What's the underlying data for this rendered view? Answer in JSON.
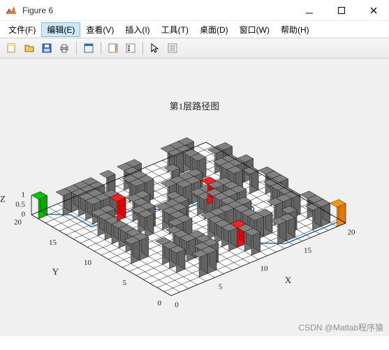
{
  "window": {
    "title": "Figure 6"
  },
  "menu": {
    "items": [
      {
        "label": "文件(F)"
      },
      {
        "label": "编辑(E)"
      },
      {
        "label": "查看(V)"
      },
      {
        "label": "插入(I)"
      },
      {
        "label": "工具(T)"
      },
      {
        "label": "桌面(D)"
      },
      {
        "label": "窗口(W)"
      },
      {
        "label": "帮助(H)"
      }
    ],
    "active_index": 1
  },
  "toolbar": {
    "buttons": [
      {
        "name": "new-figure-icon"
      },
      {
        "name": "open-icon"
      },
      {
        "name": "save-icon"
      },
      {
        "name": "print-icon"
      },
      {
        "name": "sep"
      },
      {
        "name": "edit-plot-icon"
      },
      {
        "name": "sep"
      },
      {
        "name": "insert-colorbar-icon"
      },
      {
        "name": "insert-legend-icon"
      },
      {
        "name": "sep"
      },
      {
        "name": "pointer-icon"
      },
      {
        "name": "data-cursor-icon"
      }
    ]
  },
  "chart_data": {
    "type": "area",
    "title": "第1层路径图",
    "xlabel": "X",
    "ylabel": "Y",
    "zlabel": "Z",
    "xlim": [
      0,
      20
    ],
    "ylim": [
      0,
      20
    ],
    "zlim": [
      0,
      1
    ],
    "xticks": [
      0,
      5,
      10,
      15,
      20
    ],
    "yticks": [
      0,
      5,
      10,
      15,
      20
    ],
    "zticks": [
      0,
      0.5,
      1
    ],
    "grid": {
      "nx": 20,
      "ny": 20
    },
    "obstacles": [
      [
        2,
        18
      ],
      [
        3,
        18
      ],
      [
        4,
        18
      ],
      [
        5,
        18
      ],
      [
        7,
        18
      ],
      [
        9,
        18
      ],
      [
        10,
        18
      ],
      [
        14,
        18
      ],
      [
        15,
        18
      ],
      [
        16,
        18
      ],
      [
        3,
        17
      ],
      [
        4,
        17
      ],
      [
        5,
        17
      ],
      [
        9,
        17
      ],
      [
        14,
        17
      ],
      [
        15,
        17
      ],
      [
        3,
        16
      ],
      [
        4,
        16
      ],
      [
        8,
        16
      ],
      [
        9,
        16
      ],
      [
        15,
        16
      ],
      [
        3,
        15
      ],
      [
        4,
        15
      ],
      [
        5,
        15
      ],
      [
        8,
        15
      ],
      [
        9,
        15
      ],
      [
        12,
        15
      ],
      [
        15,
        15
      ],
      [
        17,
        15
      ],
      [
        18,
        15
      ],
      [
        2,
        13
      ],
      [
        3,
        13
      ],
      [
        6,
        13
      ],
      [
        7,
        13
      ],
      [
        10,
        13
      ],
      [
        11,
        13
      ],
      [
        12,
        13
      ],
      [
        13,
        13
      ],
      [
        16,
        13
      ],
      [
        17,
        13
      ],
      [
        2,
        12
      ],
      [
        6,
        12
      ],
      [
        11,
        12
      ],
      [
        12,
        12
      ],
      [
        16,
        12
      ],
      [
        17,
        12
      ],
      [
        18,
        12
      ],
      [
        2,
        11
      ],
      [
        5,
        11
      ],
      [
        6,
        11
      ],
      [
        9,
        11
      ],
      [
        16,
        11
      ],
      [
        2,
        10
      ],
      [
        5,
        10
      ],
      [
        7,
        10
      ],
      [
        8,
        10
      ],
      [
        9,
        10
      ],
      [
        11,
        10
      ],
      [
        12,
        10
      ],
      [
        13,
        10
      ],
      [
        14,
        10
      ],
      [
        17,
        10
      ],
      [
        2,
        9
      ],
      [
        7,
        9
      ],
      [
        8,
        9
      ],
      [
        11,
        9
      ],
      [
        12,
        9
      ],
      [
        14,
        9
      ],
      [
        18,
        9
      ],
      [
        2,
        8
      ],
      [
        7,
        8
      ],
      [
        12,
        8
      ],
      [
        13,
        8
      ],
      [
        14,
        8
      ],
      [
        18,
        8
      ],
      [
        1,
        7
      ],
      [
        2,
        7
      ],
      [
        6,
        7
      ],
      [
        7,
        7
      ],
      [
        12,
        7
      ],
      [
        17,
        7
      ],
      [
        18,
        7
      ],
      [
        5,
        6
      ],
      [
        9,
        6
      ],
      [
        10,
        6
      ],
      [
        11,
        6
      ],
      [
        12,
        6
      ],
      [
        13,
        6
      ],
      [
        17,
        6
      ],
      [
        3,
        5
      ],
      [
        5,
        5
      ],
      [
        9,
        5
      ],
      [
        12,
        5
      ],
      [
        17,
        5
      ],
      [
        3,
        4
      ],
      [
        5,
        4
      ],
      [
        6,
        4
      ],
      [
        9,
        4
      ],
      [
        12,
        4
      ],
      [
        15,
        4
      ],
      [
        16,
        4
      ],
      [
        17,
        4
      ],
      [
        3,
        3
      ],
      [
        6,
        3
      ],
      [
        9,
        3
      ],
      [
        10,
        3
      ],
      [
        12,
        3
      ],
      [
        13,
        3
      ],
      [
        18,
        3
      ],
      [
        5,
        2
      ],
      [
        6,
        2
      ],
      [
        10,
        2
      ],
      [
        15,
        2
      ],
      [
        18,
        2
      ],
      [
        4,
        1
      ],
      [
        5,
        1
      ],
      [
        10,
        1
      ],
      [
        13,
        1
      ],
      [
        14,
        1
      ],
      [
        17,
        1
      ],
      [
        18,
        1
      ]
    ],
    "start": [
      0,
      19
    ],
    "goal": [
      19,
      0
    ],
    "markers": [
      {
        "pos": [
          5,
          14
        ],
        "color": "red"
      },
      {
        "pos": [
          13,
          11
        ],
        "color": "red"
      },
      {
        "pos": [
          10,
          3
        ],
        "color": "red"
      }
    ],
    "path_segments": [
      [
        [
          0,
          19
        ],
        [
          1,
          18
        ],
        [
          2,
          17
        ],
        [
          2,
          16
        ],
        [
          2,
          15
        ],
        [
          2,
          14
        ],
        [
          3,
          14
        ],
        [
          4,
          14
        ],
        [
          5,
          14
        ]
      ],
      [
        [
          5,
          14
        ],
        [
          6,
          14
        ],
        [
          7,
          14
        ],
        [
          8,
          13
        ],
        [
          9,
          12
        ],
        [
          10,
          12
        ],
        [
          10,
          11
        ],
        [
          11,
          11
        ],
        [
          12,
          11
        ],
        [
          13,
          11
        ]
      ],
      [
        [
          13,
          11
        ],
        [
          14,
          11
        ],
        [
          15,
          10
        ],
        [
          15,
          9
        ],
        [
          15,
          8
        ],
        [
          15,
          7
        ],
        [
          14,
          6
        ],
        [
          14,
          5
        ],
        [
          14,
          4
        ],
        [
          13,
          3
        ],
        [
          12,
          3
        ],
        [
          11,
          3
        ],
        [
          10,
          3
        ]
      ],
      [
        [
          10,
          3
        ],
        [
          11,
          2
        ],
        [
          12,
          1
        ],
        [
          13,
          0
        ],
        [
          14,
          0
        ],
        [
          15,
          0
        ],
        [
          16,
          0
        ],
        [
          17,
          0
        ],
        [
          18,
          0
        ],
        [
          19,
          0
        ]
      ]
    ],
    "colors": {
      "obstacle": "#808080",
      "grid": "#000000",
      "path": "#1f6fd0",
      "start": "#00c800",
      "goal": "#ff9600",
      "marker": "#ff2020",
      "background": "#f0f0f0"
    }
  },
  "watermark": "CSDN @Matlab程序猿"
}
